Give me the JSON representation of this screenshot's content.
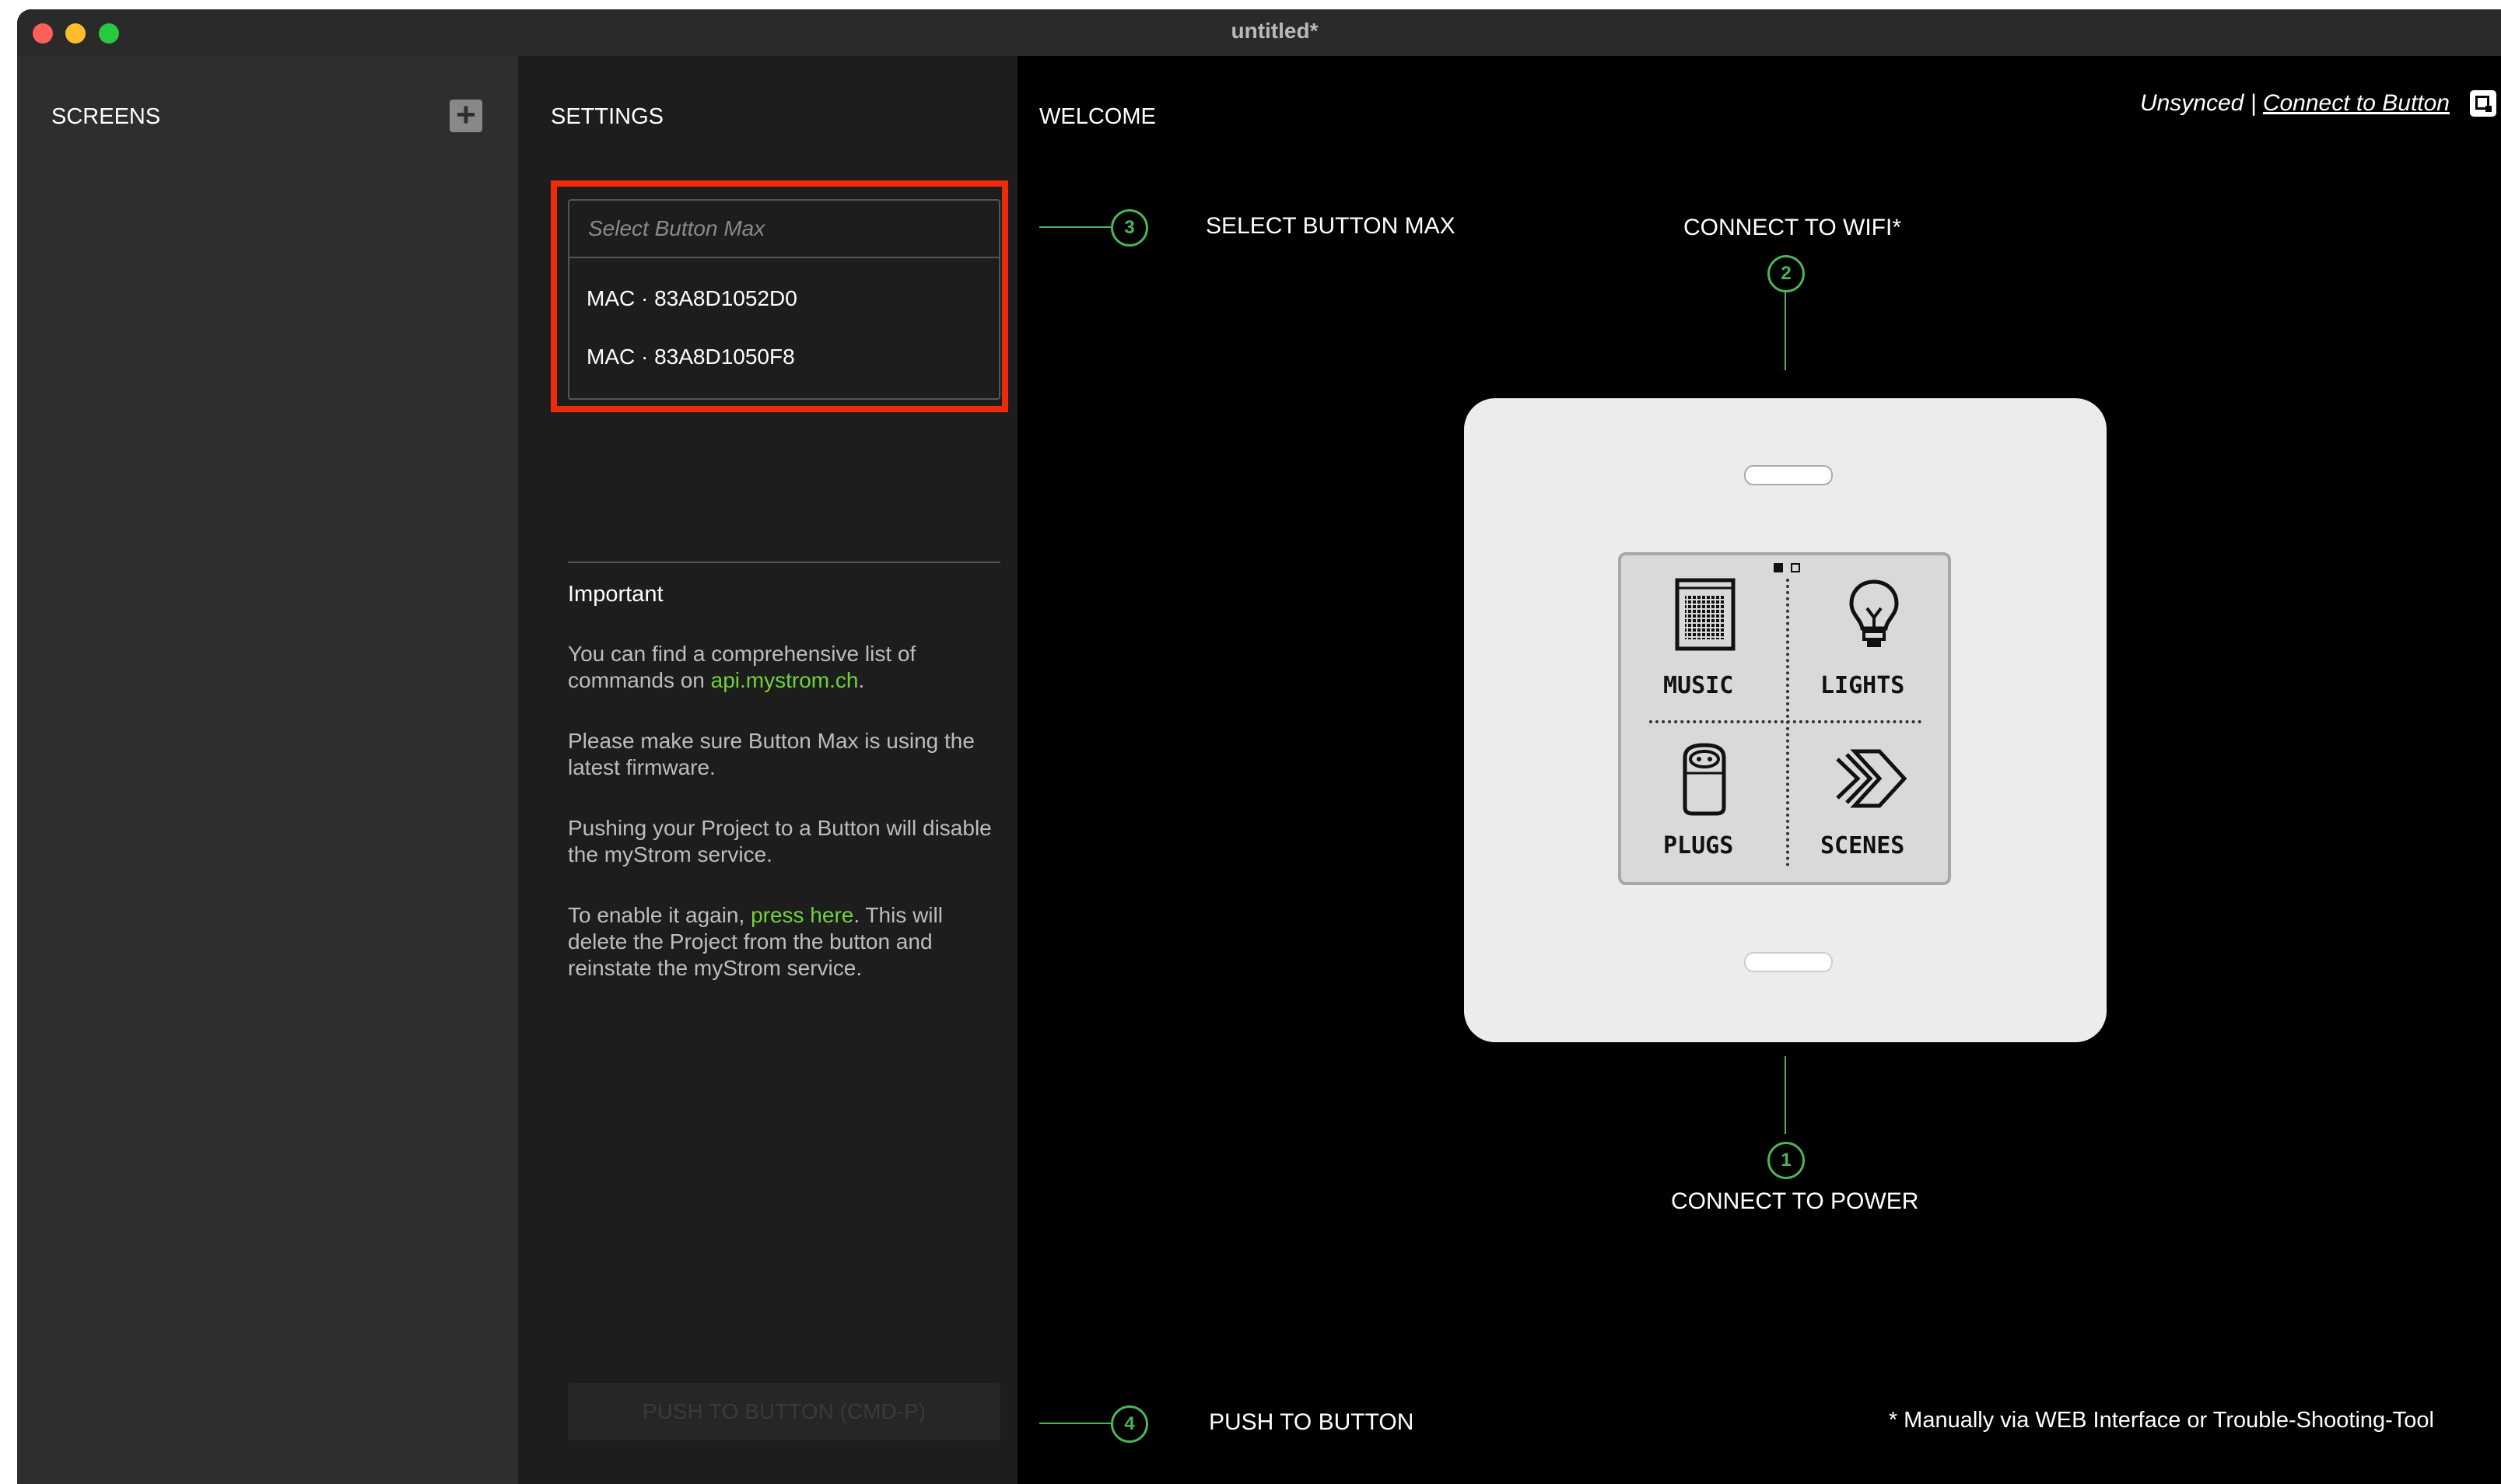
{
  "window": {
    "title": "untitled*"
  },
  "screens_panel": {
    "heading": "SCREENS",
    "add_icon": "plus-icon"
  },
  "settings_panel": {
    "heading": "SETTINGS",
    "select": {
      "placeholder": "Select Button Max",
      "options": [
        "MAC · 83A8D1052D0",
        "MAC · 83A8D1050F8"
      ]
    },
    "important": {
      "title": "Important",
      "p1_before": "You can find a comprehensive list of commands on ",
      "p1_link": "api.mystrom.ch",
      "p1_after": ".",
      "p2": "Please make sure Button Max is using the latest firmware.",
      "p3": "Pushing your Project to a Button will disable the myStrom service.",
      "p4_before": "To enable it again, ",
      "p4_link": "press here",
      "p4_after": ". This will delete the Project from the button and reinstate the myStrom service."
    },
    "push_button_label": "PUSH TO BUTTON (CMD-P)"
  },
  "welcome_panel": {
    "heading": "WELCOME",
    "sync_status": "Unsynced",
    "connect_link": "Connect to Button",
    "steps": [
      {
        "number": "1",
        "label": "CONNECT TO POWER"
      },
      {
        "number": "2",
        "label": "CONNECT TO WIFI*"
      },
      {
        "number": "3",
        "label": "SELECT BUTTON MAX"
      },
      {
        "number": "4",
        "label": "PUSH TO BUTTON"
      }
    ],
    "device_tiles": [
      "MUSIC",
      "LIGHTS",
      "PLUGS",
      "SCENES"
    ],
    "footnote": "* Manually via WEB Interface or Trouble-Shooting-Tool"
  },
  "colors": {
    "accent_green": "#4db35a",
    "link_green": "#6fd23a",
    "highlight_red": "#ee2a0b"
  }
}
